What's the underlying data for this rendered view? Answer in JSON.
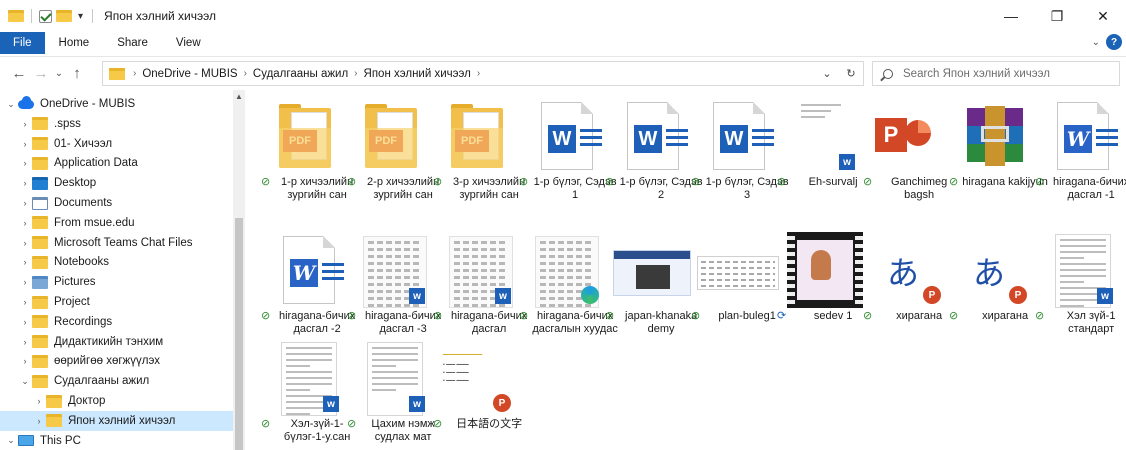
{
  "window": {
    "title": "Япон хэлний хичээл",
    "controls": {
      "minimize": "—",
      "maximize": "❐",
      "close": "✕"
    }
  },
  "ribbon": {
    "tabs": [
      "File",
      "Home",
      "Share",
      "View"
    ],
    "expand": "⌄",
    "help": "?"
  },
  "nav": {
    "back": "←",
    "forward": "→",
    "recent": "⌄",
    "up": "↑",
    "breadcrumb": [
      "OneDrive - MUBIS",
      "Судалгааны ажил",
      "Япон хэлний хичээл"
    ],
    "refresh": "↻",
    "history": "⌄",
    "search_placeholder": "Search Япон хэлний хичээл"
  },
  "tree": [
    {
      "label": "OneDrive - MUBIS",
      "icon": "cloud",
      "twisty": "⌄",
      "indent": 0
    },
    {
      "label": ".spss",
      "icon": "folder",
      "twisty": "›",
      "indent": 1
    },
    {
      "label": "01- Хичээл",
      "icon": "folder",
      "twisty": "›",
      "indent": 1
    },
    {
      "label": "Application Data",
      "icon": "folder",
      "twisty": "›",
      "indent": 1
    },
    {
      "label": "Desktop",
      "icon": "desktop",
      "twisty": "›",
      "indent": 1
    },
    {
      "label": "Documents",
      "icon": "documents",
      "twisty": "›",
      "indent": 1
    },
    {
      "label": "From msue.edu",
      "icon": "folder",
      "twisty": "›",
      "indent": 1
    },
    {
      "label": "Microsoft Teams Chat Files",
      "icon": "folder",
      "twisty": "›",
      "indent": 1
    },
    {
      "label": "Notebooks",
      "icon": "folder",
      "twisty": "›",
      "indent": 1
    },
    {
      "label": "Pictures",
      "icon": "pictures",
      "twisty": "›",
      "indent": 1
    },
    {
      "label": "Project",
      "icon": "folder",
      "twisty": "›",
      "indent": 1
    },
    {
      "label": "Recordings",
      "icon": "folder",
      "twisty": "›",
      "indent": 1
    },
    {
      "label": "Дидактикийн тэнхим",
      "icon": "folder",
      "twisty": "›",
      "indent": 1
    },
    {
      "label": "өөрийгөө хөгжүүлэх",
      "icon": "folder",
      "twisty": "›",
      "indent": 1
    },
    {
      "label": "Судалгааны ажил",
      "icon": "folder",
      "twisty": "⌄",
      "indent": 1
    },
    {
      "label": "Доктор",
      "icon": "folder",
      "twisty": "›",
      "indent": 2
    },
    {
      "label": "Япон хэлний хичээл",
      "icon": "folder",
      "twisty": "›",
      "indent": 2,
      "selected": true
    },
    {
      "label": "This PC",
      "icon": "pc",
      "twisty": "⌄",
      "indent": 0
    }
  ],
  "files": [
    {
      "name": "1-р хичээлийн зургийн сан",
      "kind": "pdf-folder",
      "status": "synced"
    },
    {
      "name": "2-р хичээлийн зургийн сан",
      "kind": "pdf-folder",
      "status": "synced"
    },
    {
      "name": "3-р хичээлийн зургийн сан",
      "kind": "pdf-folder",
      "status": "synced"
    },
    {
      "name": "1-р бүлэг, Сэдэв 1",
      "kind": "word",
      "status": "synced"
    },
    {
      "name": "1-р бүлэг, Сэдэв 2",
      "kind": "word",
      "status": "synced"
    },
    {
      "name": "1-р бүлэг, Сэдэв 3",
      "kind": "word",
      "status": "synced"
    },
    {
      "name": "Eh-survalj",
      "kind": "doc-thumb",
      "status": "synced"
    },
    {
      "name": "Ganchimeg bagsh",
      "kind": "ppt",
      "status": "synced"
    },
    {
      "name": "hiragana kakijyun",
      "kind": "rar",
      "status": "synced"
    },
    {
      "name": "hiragana-бичих дасгал -1",
      "kind": "word-old",
      "status": "synced"
    },
    {
      "name": "hiragana-бичих дасгал -2",
      "kind": "word-old",
      "status": "synced"
    },
    {
      "name": "hiragana-бичих дасгал -3",
      "kind": "sheet-word",
      "status": "synced"
    },
    {
      "name": "hiragana-бичих дасгал",
      "kind": "sheet-word",
      "status": "synced"
    },
    {
      "name": "hiragana-бичих дасгалын хуудас",
      "kind": "sheet-edge",
      "status": "synced"
    },
    {
      "name": "japan-khanaka demy",
      "kind": "slide",
      "status": "synced"
    },
    {
      "name": "plan-buleg1",
      "kind": "plan",
      "status": "synced"
    },
    {
      "name": "sedev 1",
      "kind": "video",
      "status": "syncing"
    },
    {
      "name": "хирагана",
      "kind": "hira-ppt",
      "status": "synced"
    },
    {
      "name": "хирагана",
      "kind": "hira-ppt",
      "status": "synced"
    },
    {
      "name": "Хэл зүй-1 стандарт",
      "kind": "doc-word",
      "status": "synced"
    },
    {
      "name": "Хэл-зүй-1-бүлэг-1-у.сан",
      "kind": "doc-word",
      "status": "synced"
    },
    {
      "name": "Цахим нэмж судлах мат",
      "kind": "doc-word-small",
      "status": "synced"
    },
    {
      "name": "日本語の文字",
      "kind": "yellow-ppt",
      "status": "synced"
    }
  ],
  "status_glyphs": {
    "synced": "⊘",
    "syncing": "⟳"
  },
  "colors": {
    "accent": "#1b63b7",
    "selected_bg": "#cce8ff",
    "folder": "#f7c948",
    "word": "#1e5fb8",
    "ppt": "#d24726",
    "pdf": "#e1462c",
    "synced": "#2e8b2e"
  }
}
